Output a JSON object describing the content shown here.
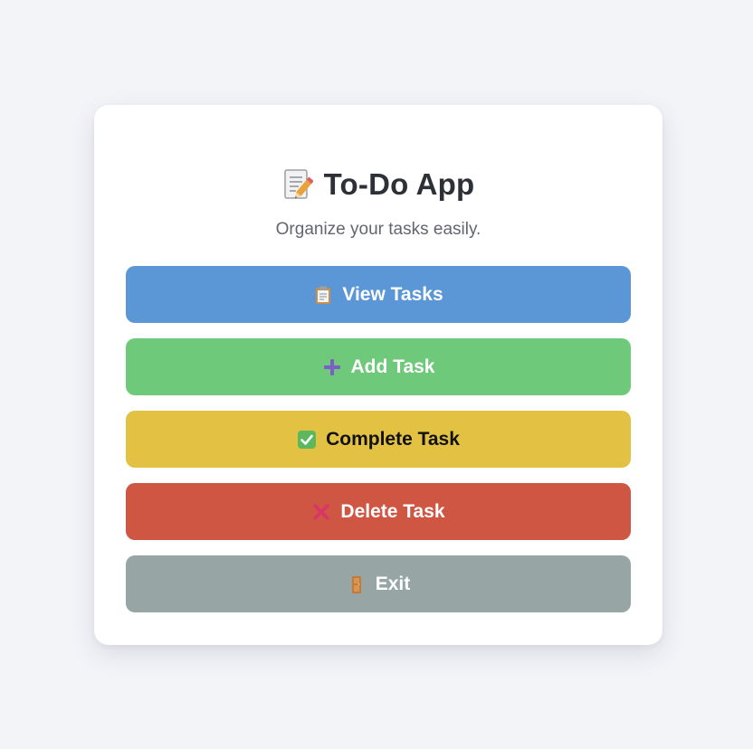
{
  "app": {
    "title": "To-Do App",
    "subtitle": "Organize your tasks easily.",
    "title_icon": "memo-icon"
  },
  "menu": {
    "items": [
      {
        "label": "View Tasks",
        "icon": "clipboard-icon",
        "color": "#5b97d6"
      },
      {
        "label": "Add Task",
        "icon": "plus-icon",
        "color": "#6fc97b"
      },
      {
        "label": "Complete Task",
        "icon": "check-icon",
        "color": "#e3c243"
      },
      {
        "label": "Delete Task",
        "icon": "cross-icon",
        "color": "#cf5643"
      },
      {
        "label": "Exit",
        "icon": "door-icon",
        "color": "#97a5a5"
      }
    ]
  },
  "colors": {
    "background": "#f3f4f8",
    "card": "#ffffff",
    "title_text": "#2d3137",
    "subtitle_text": "#62666d"
  }
}
